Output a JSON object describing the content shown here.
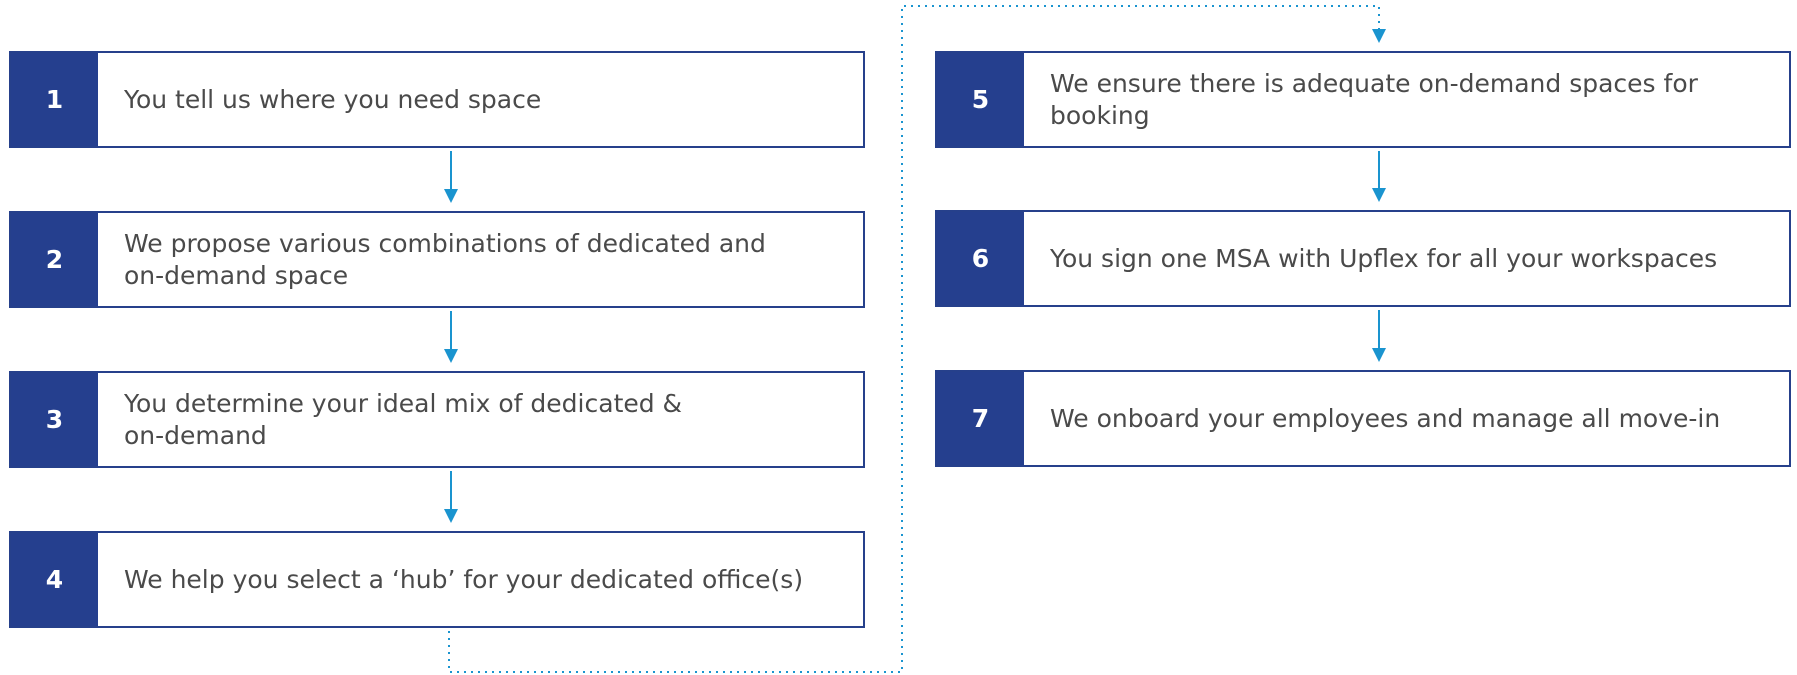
{
  "colors": {
    "box_fill": "#253f8e",
    "box_border": "#26408b",
    "text": "#4a4a4a",
    "connector": "#1a94cf"
  },
  "steps": [
    {
      "number": "1",
      "text": "You tell us where you need space"
    },
    {
      "number": "2",
      "line1": "We propose various combinations of dedicated and",
      "line2": "on-demand space"
    },
    {
      "number": "3",
      "line1": "You determine your ideal mix of dedicated &",
      "line2": "on-demand"
    },
    {
      "number": "4",
      "text": "We help you select a ‘hub’ for your dedicated office(s)"
    },
    {
      "number": "5",
      "line1": "We ensure there is adequate on-demand spaces for",
      "line2": "booking"
    },
    {
      "number": "6",
      "text": "You sign one MSA with Upflex for all your workspaces"
    },
    {
      "number": "7",
      "text": "We onboard your employees and manage all move-in"
    }
  ]
}
